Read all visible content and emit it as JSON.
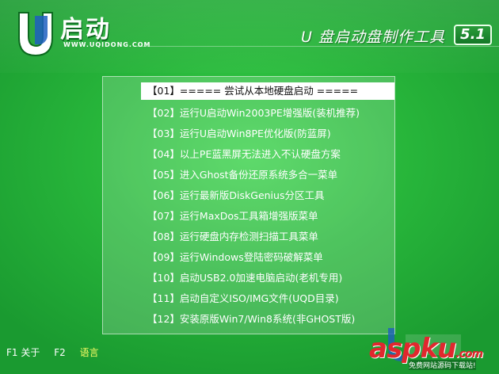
{
  "header": {
    "logo_text": "启动",
    "logo_url": "WWW.UQIDONG.COM",
    "title": "U 盘启动盘制作工具",
    "version": "5.1"
  },
  "menu": {
    "items": [
      {
        "label": "【01】===== 尝试从本地硬盘启动 ====="
      },
      {
        "label": "【02】运行U启动Win2003PE增强版(装机推荐)"
      },
      {
        "label": "【03】运行U启动Win8PE优化版(防蓝屏)"
      },
      {
        "label": "【04】以上PE蓝黑屏无法进入不认硬盘方案"
      },
      {
        "label": "【05】进入Ghost备份还原系统多合一菜单"
      },
      {
        "label": "【06】运行最新版DiskGenius分区工具"
      },
      {
        "label": "【07】运行MaxDos工具箱增强版菜单"
      },
      {
        "label": "【08】运行硬盘内存检测扫描工具菜单"
      },
      {
        "label": "【09】运行Windows登陆密码破解菜单"
      },
      {
        "label": "【10】启动USB2.0加速电脑启动(老机专用)"
      },
      {
        "label": "【11】启动自定义ISO/IMG文件(UQD目录)"
      },
      {
        "label": "【12】安装原版Win7/Win8系统(非GHOST版)"
      }
    ],
    "selected_index": 0
  },
  "footer": {
    "f1": "F1 关于",
    "f2_key": "F2",
    "f2_label": "语言"
  },
  "watermark": {
    "brand": "aspku",
    "domain_suffix": ".com",
    "sub": "免费网站源码下载站!"
  },
  "colors": {
    "background": "#28b73b",
    "selected_bg": "#ffffff",
    "watermark_red": "#e0282e"
  }
}
